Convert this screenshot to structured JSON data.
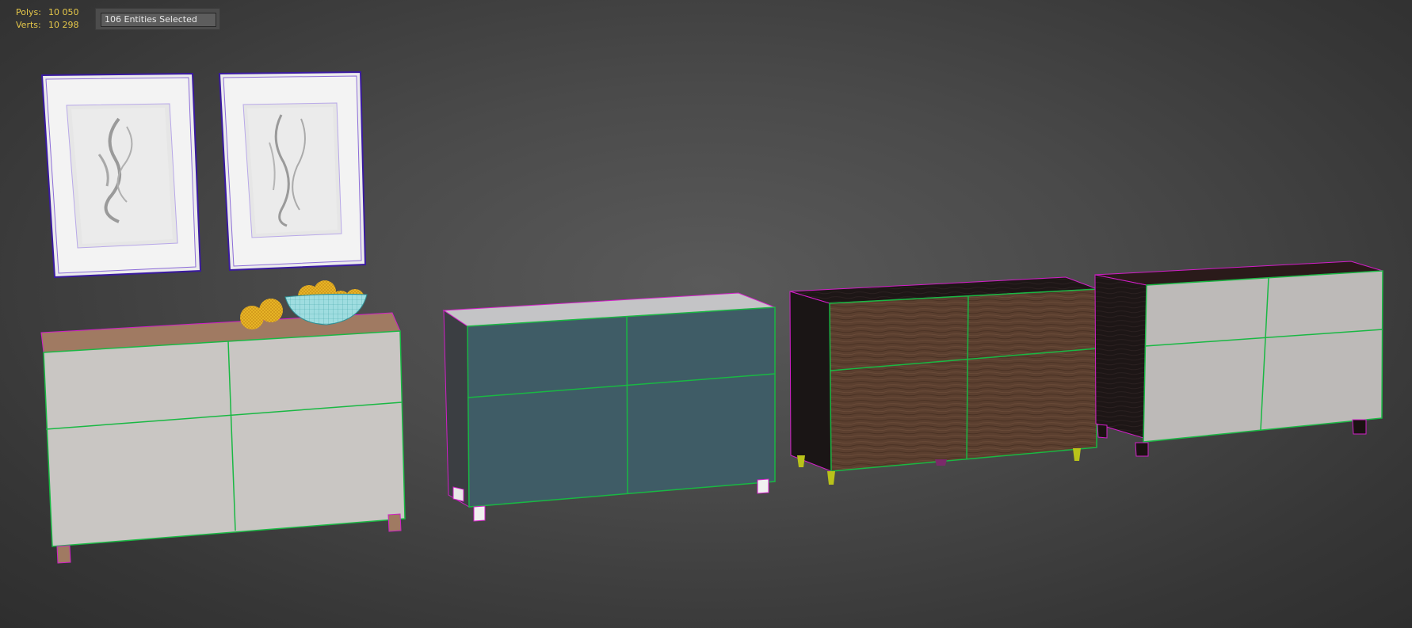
{
  "stats": {
    "polys_label": "Polys:",
    "polys_value": "10 050",
    "verts_label": "Verts:",
    "verts_value": "10 298"
  },
  "selection": {
    "value": "106 Entities Selected"
  },
  "colors": {
    "stats_text": "#e6c84a",
    "edge_green": "#19b843",
    "edge_magenta": "#d21ec8",
    "edge_purple": "#3a1aa0",
    "teal_front": "#3f5c66",
    "walnut": "#5a3e2e",
    "white_front": "#bfbcb9"
  },
  "scene_objects": [
    "picture-frame-left",
    "picture-frame-right",
    "white-sideboard",
    "fruit-bowl",
    "teal-sideboard",
    "walnut-sideboard",
    "black-white-sideboard"
  ]
}
